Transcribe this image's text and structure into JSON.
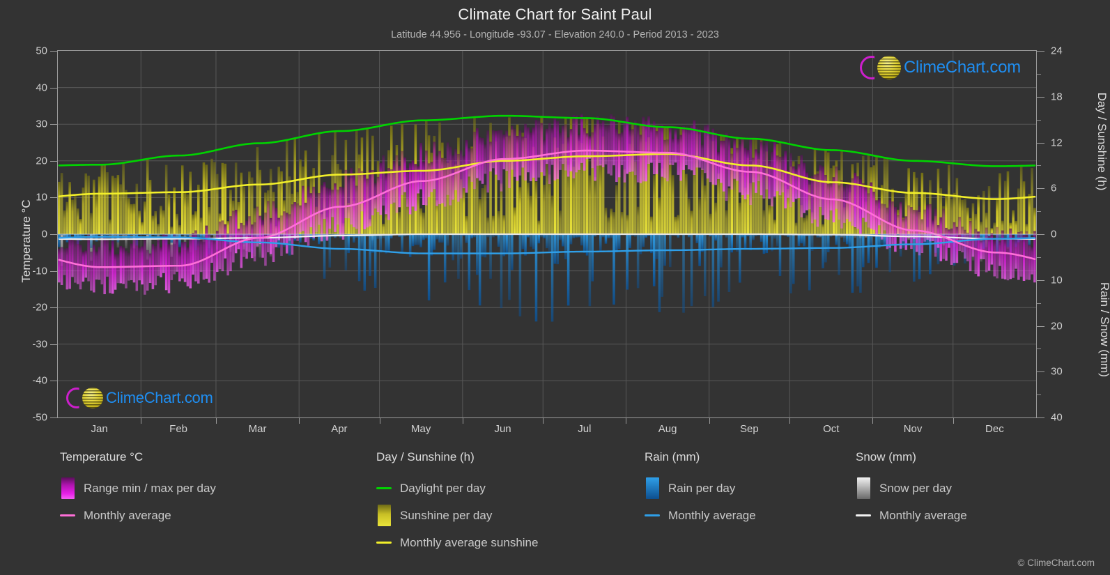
{
  "header": {
    "title": "Climate Chart for Saint Paul",
    "subtitle": "Latitude 44.956 - Longitude -93.07 - Elevation 240.0 - Period 2013 - 2023"
  },
  "watermark": {
    "text": "ClimeChart.com"
  },
  "footer": {
    "text": "© ClimeChart.com"
  },
  "axes": {
    "left_label": "Temperature °C",
    "right_label_top": "Day / Sunshine (h)",
    "right_label_bottom": "Rain / Snow (mm)",
    "left_ticks": [
      "50",
      "40",
      "30",
      "20",
      "10",
      "0",
      "-10",
      "-20",
      "-30",
      "-40",
      "-50"
    ],
    "right_ticks_top": [
      "24",
      "18",
      "12",
      "6",
      "0"
    ],
    "right_ticks_bottom": [
      "10",
      "20",
      "30",
      "40"
    ],
    "x_ticks": [
      "Jan",
      "Feb",
      "Mar",
      "Apr",
      "May",
      "Jun",
      "Jul",
      "Aug",
      "Sep",
      "Oct",
      "Nov",
      "Dec"
    ]
  },
  "legend": {
    "columns": [
      {
        "heading": "Temperature °C",
        "items": [
          {
            "label": "Range min / max per day",
            "swatch": "gradient",
            "color": "#e000e0"
          },
          {
            "label": "Monthly average",
            "swatch": "line",
            "color": "#ff6fd8"
          }
        ]
      },
      {
        "heading": "Day / Sunshine (h)",
        "items": [
          {
            "label": "Daylight per day",
            "swatch": "line",
            "color": "#00d400"
          },
          {
            "label": "Sunshine per day",
            "swatch": "gradient",
            "color": "#e8e020"
          },
          {
            "label": "Monthly average sunshine",
            "swatch": "line",
            "color": "#f2ef2a"
          }
        ]
      },
      {
        "heading": "Rain (mm)",
        "items": [
          {
            "label": "Rain per day",
            "swatch": "gradient",
            "color": "#1787e0"
          },
          {
            "label": "Monthly average",
            "swatch": "line",
            "color": "#2f9fe8"
          }
        ]
      },
      {
        "heading": "Snow (mm)",
        "items": [
          {
            "label": "Snow per day",
            "swatch": "gradient",
            "color": "#e8e8e8"
          },
          {
            "label": "Monthly average",
            "swatch": "line",
            "color": "#f2f2f2"
          }
        ]
      }
    ]
  },
  "colors": {
    "background": "#333333",
    "grid": "#585858",
    "axis": "#9a9a9a",
    "temp_range": "#e000e0",
    "temp_avg": "#ff6fd8",
    "daylight": "#00d400",
    "sunshine_bar": "#d8cf28",
    "sunshine_avg": "#f2ef2a",
    "rain_bar": "#1787e0",
    "rain_avg": "#2f9fe8",
    "snow_bar": "#cfcfcf",
    "snow_avg": "#f2f2f2",
    "logo_magenta": "#cc1fcc",
    "logo_blue": "#1f8ef1",
    "logo_yellow": "#e6d83c"
  },
  "chart_data": {
    "type": "line",
    "title": "Climate Chart for Saint Paul",
    "subtitle": "Latitude 44.956 - Longitude -93.07 - Elevation 240.0 - Period 2013 - 2023",
    "xlabel": "",
    "ylabel": "Temperature °C",
    "ylim": [
      -50,
      50
    ],
    "y2lim_day_sunshine": [
      0,
      24
    ],
    "y2lim_rain_snow": [
      0,
      40
    ],
    "grid": true,
    "legend_position": "bottom",
    "categories": [
      "Jan",
      "Feb",
      "Mar",
      "Apr",
      "May",
      "Jun",
      "Jul",
      "Aug",
      "Sep",
      "Oct",
      "Nov",
      "Dec"
    ],
    "series": [
      {
        "name": "Monthly average temperature",
        "unit": "°C",
        "color": "#ff6fd8",
        "axis": "left",
        "values": [
          -9.0,
          -8.6,
          -1.0,
          7.5,
          14.5,
          20.5,
          22.8,
          22.2,
          17.0,
          9.5,
          1.0,
          -5.0
        ]
      },
      {
        "name": "Daily max temperature (range top)",
        "unit": "°C",
        "color": "#e000e0",
        "axis": "left",
        "values": [
          -3.5,
          -2.5,
          5.5,
          14.0,
          21.5,
          27.0,
          29.5,
          28.5,
          23.5,
          15.5,
          6.0,
          -0.5
        ]
      },
      {
        "name": "Daily min temperature (range bottom)",
        "unit": "°C",
        "color": "#e000e0",
        "axis": "left",
        "values": [
          -14.5,
          -13.5,
          -6.0,
          1.5,
          8.5,
          14.5,
          17.0,
          16.0,
          11.0,
          4.0,
          -3.5,
          -10.0
        ]
      },
      {
        "name": "Daylight per day",
        "unit": "h",
        "color": "#00d400",
        "axis": "right_top",
        "values": [
          9.1,
          10.3,
          11.9,
          13.5,
          14.9,
          15.5,
          15.2,
          14.0,
          12.5,
          11.0,
          9.6,
          8.9
        ]
      },
      {
        "name": "Monthly average sunshine",
        "unit": "h",
        "color": "#f2ef2a",
        "axis": "right_top",
        "values": [
          5.3,
          5.5,
          6.5,
          7.8,
          8.3,
          9.6,
          10.2,
          10.5,
          9.0,
          6.8,
          5.4,
          4.6
        ]
      },
      {
        "name": "Monthly average rain",
        "unit": "mm",
        "color": "#2f9fe8",
        "axis": "right_bottom",
        "values": [
          0.6,
          0.7,
          1.8,
          3.2,
          4.2,
          4.2,
          3.8,
          3.5,
          3.2,
          3.0,
          2.2,
          1.0
        ]
      },
      {
        "name": "Monthly average snow",
        "unit": "mm",
        "color": "#f2f2f2",
        "axis": "right_bottom",
        "values": [
          1.1,
          1.0,
          0.8,
          0.3,
          0.0,
          0.0,
          0.0,
          0.0,
          0.0,
          0.1,
          0.5,
          1.0
        ]
      }
    ]
  }
}
